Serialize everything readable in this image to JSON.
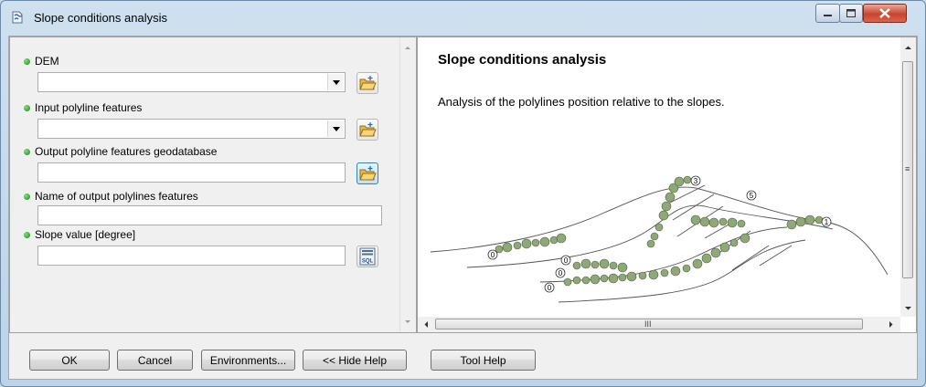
{
  "window": {
    "title": "Slope conditions analysis",
    "icon": "toolbox-script-icon",
    "controls": [
      "minimize-icon",
      "maximize-icon",
      "close-icon"
    ]
  },
  "params": [
    {
      "label": "DEM",
      "value": "",
      "type": "combo-with-browse"
    },
    {
      "label": "Input polyline features",
      "value": "",
      "type": "combo-with-browse"
    },
    {
      "label": "Output polyline features geodatabase",
      "value": "",
      "type": "text-with-browse"
    },
    {
      "label": "Name of output polylines features",
      "value": "",
      "type": "text"
    },
    {
      "label": "Slope value [degree]",
      "value": "",
      "type": "text-with-sql"
    }
  ],
  "help": {
    "title": "Slope conditions analysis",
    "description": "Analysis of the polylines position relative to the slopes.",
    "figure_labels": [
      "3",
      "5",
      "1",
      "0",
      "0",
      "0",
      "0"
    ]
  },
  "buttons": {
    "ok": "OK",
    "cancel": "Cancel",
    "environments": "Environments...",
    "hide_help": "<< Hide Help",
    "tool_help": "Tool Help"
  },
  "sql_icon_text": "SQL",
  "scroll_grip": "III",
  "colors": {
    "required_dot": "#22aa22",
    "tree": "#8fa878",
    "close_button": "#c8452c"
  }
}
